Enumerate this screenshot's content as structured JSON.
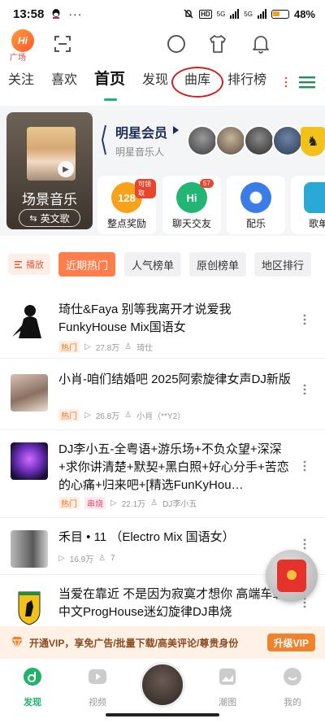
{
  "status_bar": {
    "time": "13:58",
    "hd": "HD",
    "net1": "5G",
    "net2": "5G",
    "battery": "48%"
  },
  "top_bar": {
    "square_logo": "Hi",
    "square_label": "广场"
  },
  "tabs": [
    "关注",
    "喜欢",
    "首页",
    "发现",
    "曲库",
    "排行榜"
  ],
  "feature": {
    "scene_title": "场景音乐",
    "scene_pill": "英文歌",
    "star_title": "明星会员",
    "star_sub": "明星音乐人",
    "mini_cards": [
      {
        "label": "整点奖励",
        "icon_text": "128",
        "badge": "可领取",
        "color": "#f7a21b"
      },
      {
        "label": "聊天交友",
        "icon_text": "Hi",
        "badge": "57",
        "color": "#22b573"
      },
      {
        "label": "配乐",
        "icon_text": "",
        "badge": "",
        "color": "#3b7de6"
      },
      {
        "label": "歌单",
        "icon_text": "",
        "badge": "",
        "color": "#2aa8d6"
      }
    ]
  },
  "filters": {
    "play": "播放",
    "chips": [
      "近期热门",
      "人气榜单",
      "原创榜单",
      "地区排行"
    ]
  },
  "songs": [
    {
      "title": "琦仕&Faya 别等我离开才说爱我FunkyHouse Mix国语女",
      "tags": [
        "热门"
      ],
      "plays": "27.8万",
      "artist": "琦仕",
      "cover": "silhouette"
    },
    {
      "title": "小肖-咱们结婚吧 2025阿索旋律女声DJ新版",
      "tags": [
        "热门"
      ],
      "plays": "26.8万",
      "artist": "小肖（**Y2）",
      "cover": "girl"
    },
    {
      "title": "DJ李小五-全粤语+游乐场+不负众望+深深+求你讲清楚+默契+黑白照+好心分手+苦恋的心痛+归来吧+[精选FunKyHou…",
      "tags": [
        "热门",
        "串烧"
      ],
      "plays": "22.1万",
      "artist": "DJ李小五",
      "cover": "purple"
    },
    {
      "title": "禾目 • 11 （Electro Mix 国语女）",
      "tags": [],
      "plays": "16.9万",
      "artist": "7",
      "cover": "grey"
    },
    {
      "title": "当爱在靠近 不是因为寂寞才想你 高端车载中文ProgHouse迷幻旋律DJ串烧",
      "tags": [],
      "plays": "",
      "artist": "",
      "cover": "ferrari"
    }
  ],
  "vip_banner": {
    "text": "开通VIP，享免广告/批量下载/高美评论/尊贵身份",
    "button": "升级VIP"
  },
  "bottom_nav": [
    "发现",
    "视频",
    "潮图",
    "我的"
  ],
  "colors": {
    "accent": "#1fb46a",
    "orange": "#ff7e4b",
    "vip": "#f0822d"
  }
}
